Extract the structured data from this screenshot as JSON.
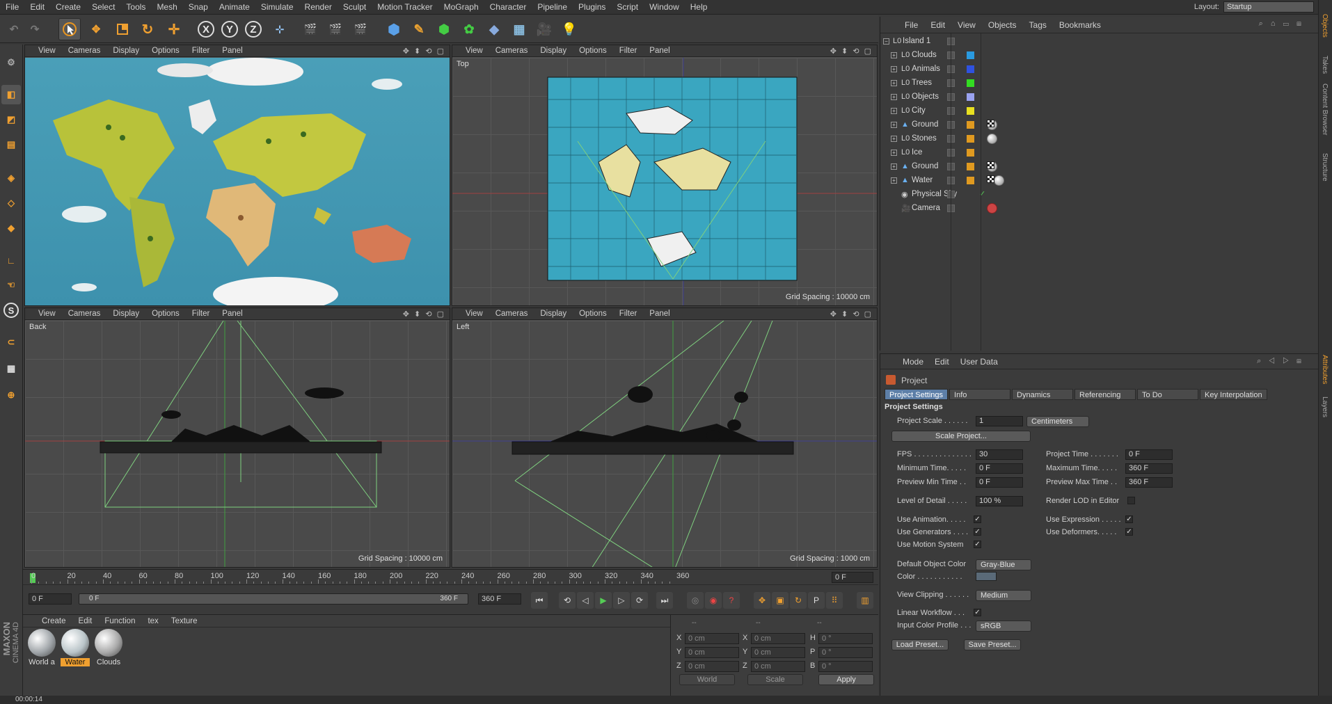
{
  "menubar": {
    "items": [
      "File",
      "Edit",
      "Create",
      "Select",
      "Tools",
      "Mesh",
      "Snap",
      "Animate",
      "Simulate",
      "Render",
      "Sculpt",
      "Motion Tracker",
      "MoGraph",
      "Character",
      "Pipeline",
      "Plugins",
      "Script",
      "Window",
      "Help"
    ],
    "layout_label": "Layout:",
    "layout_value": "Startup"
  },
  "toolbar": {
    "x": "X",
    "y": "Y",
    "z": "Z"
  },
  "viewports": [
    {
      "menu": [
        "View",
        "Cameras",
        "Display",
        "Options",
        "Filter",
        "Panel"
      ],
      "label": "",
      "grid": ""
    },
    {
      "menu": [
        "View",
        "Cameras",
        "Display",
        "Options",
        "Filter",
        "Panel"
      ],
      "label": "Top",
      "grid": "Grid Spacing : 10000 cm"
    },
    {
      "menu": [
        "View",
        "Cameras",
        "Display",
        "Options",
        "Filter",
        "Panel"
      ],
      "label": "Back",
      "grid": "Grid Spacing : 10000 cm"
    },
    {
      "menu": [
        "View",
        "Cameras",
        "Display",
        "Options",
        "Filter",
        "Panel"
      ],
      "label": "Left",
      "grid": "Grid Spacing : 1000 cm"
    }
  ],
  "timeline": {
    "ticks": [
      "0",
      "20",
      "40",
      "60",
      "80",
      "100",
      "120",
      "140",
      "160",
      "180",
      "200",
      "220",
      "240",
      "260",
      "280",
      "300",
      "320",
      "340",
      "360"
    ],
    "current_frame": "0 F",
    "start": "0 F",
    "slider_start": "0 F",
    "slider_end": "360 F",
    "end": "360 F"
  },
  "material_manager": {
    "menu": [
      "Create",
      "Edit",
      "Function",
      "tex",
      "Texture"
    ],
    "materials": [
      {
        "name": "World a",
        "color": "#9fa4a8"
      },
      {
        "name": "Water",
        "color": "#b9c4c8"
      },
      {
        "name": "Clouds",
        "color": "#a9a9a9"
      }
    ]
  },
  "coords": {
    "rows": [
      {
        "a": "X",
        "av": "0 cm",
        "b": "X",
        "bv": "0 cm",
        "c": "H",
        "cv": "0 °"
      },
      {
        "a": "Y",
        "av": "0 cm",
        "b": "Y",
        "bv": "0 cm",
        "c": "P",
        "cv": "0 °"
      },
      {
        "a": "Z",
        "av": "0 cm",
        "b": "Z",
        "bv": "0 cm",
        "c": "B",
        "cv": "0 °"
      }
    ],
    "world": "World",
    "scale": "Scale",
    "apply": "Apply",
    "header1": "--",
    "header2": "--",
    "header3": "--"
  },
  "object_manager": {
    "menu": [
      "File",
      "Edit",
      "View",
      "Objects",
      "Tags",
      "Bookmarks"
    ],
    "objects": [
      {
        "name": "Island 1",
        "color": "",
        "tags": []
      },
      {
        "name": "Clouds",
        "color": "#2a9ae0",
        "tags": []
      },
      {
        "name": "Animals",
        "color": "#2f52e0",
        "tags": []
      },
      {
        "name": "Trees",
        "color": "#33dd22",
        "tags": []
      },
      {
        "name": "Objects",
        "color": "#9aa2f0",
        "tags": []
      },
      {
        "name": "City",
        "color": "#e8e020",
        "tags": []
      },
      {
        "name": "Ground",
        "color": "#e09a20",
        "tags": [
          "chk",
          "sph"
        ]
      },
      {
        "name": "Stones",
        "color": "#e09a20",
        "tags": [
          "sph"
        ]
      },
      {
        "name": "Ice",
        "color": "#e09a20",
        "tags": []
      },
      {
        "name": "Ground",
        "color": "#e09a20",
        "tags": [
          "sph",
          "chk"
        ]
      },
      {
        "name": "Water",
        "color": "#e09a20",
        "tags": [
          "dot",
          "chk",
          "sph"
        ]
      },
      {
        "name": "Physical Sky",
        "color": "",
        "tags": []
      },
      {
        "name": "Camera",
        "color": "",
        "tags": [
          "no"
        ]
      }
    ]
  },
  "attributes": {
    "menu": [
      "Mode",
      "Edit",
      "User Data"
    ],
    "title": "Project",
    "tabs": [
      "Project Settings",
      "Info",
      "Dynamics",
      "Referencing",
      "To Do",
      "Key Interpolation"
    ],
    "section": "Project Settings",
    "project_scale_label": "Project Scale . . . . . .",
    "project_scale_value": "1",
    "project_scale_unit": "Centimeters",
    "scale_project_btn": "Scale Project...",
    "fps_label": "FPS . . . . . . . . . . . . . .",
    "fps": "30",
    "project_time_label": "Project Time . . . . . . .",
    "project_time": "0 F",
    "min_time_label": "Minimum Time. . . . .",
    "min_time": "0 F",
    "max_time_label": "Maximum Time. . . . .",
    "max_time": "360 F",
    "prev_min_label": "Preview Min Time . .",
    "prev_min": "0 F",
    "prev_max_label": "Preview Max Time . .",
    "prev_max": "360 F",
    "lod_label": "Level of Detail . . . . .",
    "lod": "100 %",
    "render_lod_label": "Render LOD in Editor",
    "use_anim_label": "Use Animation. . . . .",
    "use_expr_label": "Use Expression . . . . .",
    "use_gen_label": "Use Generators . . . .",
    "use_def_label": "Use Deformers. . . . .",
    "use_motion_label": "Use Motion System",
    "def_color_label": "Default Object Color",
    "def_color": "Gray-Blue",
    "color_label": "Color . . . . . . . . . . .",
    "view_clip_label": "View Clipping . . . . . .",
    "view_clip": "Medium",
    "linear_label": "Linear Workflow . . .",
    "icp_label": "Input Color Profile . . .",
    "icp": "sRGB",
    "load_preset": "Load Preset...",
    "save_preset": "Save Preset..."
  },
  "side_tabs": [
    "Objects",
    "Takes",
    "Content Browser",
    "Structure",
    "Attributes",
    "Layers"
  ],
  "logo": {
    "brand": "MAXON",
    "product": "CINEMA 4D"
  },
  "status": "00:00:14"
}
